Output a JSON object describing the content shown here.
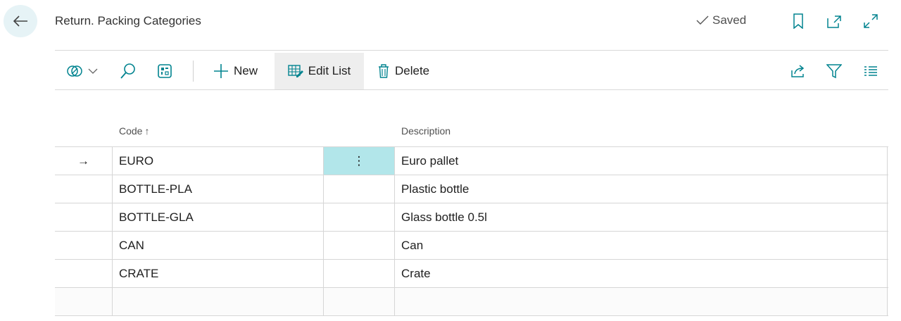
{
  "header": {
    "title": "Return. Packing Categories",
    "saved_label": "Saved",
    "icons": [
      "back-arrow-icon",
      "check-icon",
      "bookmark-icon",
      "open-new-window-icon",
      "expand-icon"
    ]
  },
  "toolbar": {
    "new_label": "New",
    "edit_list_label": "Edit List",
    "delete_label": "Delete",
    "icons": [
      "data-lens-icon",
      "chevron-down-icon",
      "search-icon",
      "analysis-icon",
      "plus-icon",
      "edit-list-icon",
      "trash-icon",
      "share-icon",
      "filter-icon",
      "list-view-icon"
    ]
  },
  "table": {
    "columns": {
      "code": "Code",
      "description": "Description"
    },
    "sort_indicator": "↑",
    "rows": [
      {
        "indicator": "→",
        "code": "EURO",
        "description": "Euro pallet"
      },
      {
        "indicator": "",
        "code": "BOTTLE-PLA",
        "description": "Plastic bottle"
      },
      {
        "indicator": "",
        "code": "BOTTLE-GLA",
        "description": "Glass bottle 0.5l"
      },
      {
        "indicator": "",
        "code": "CAN",
        "description": "Can"
      },
      {
        "indicator": "",
        "code": "CRATE",
        "description": "Crate"
      },
      {
        "indicator": "",
        "code": "",
        "description": ""
      }
    ],
    "row_menu_glyph": "⋮"
  },
  "colors": {
    "accent": "#00838f",
    "selected_cell": "#b2e6ea",
    "back_button_bg": "#e6f3f6"
  }
}
